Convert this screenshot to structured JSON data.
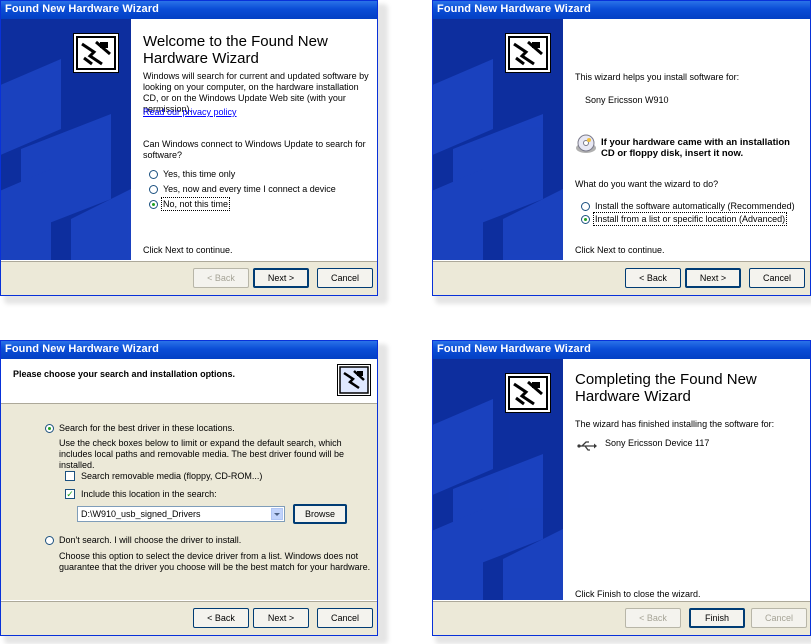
{
  "wizard_title": "Found New Hardware Wizard",
  "colors": {
    "titlebar": "#0a4dd6",
    "left_panel": "#0d2e9e",
    "dialog_bg": "#ece9d8",
    "link": "#0000ff"
  },
  "screen1": {
    "heading": "Welcome to the Found New Hardware Wizard",
    "intro": "Windows will search for current and updated software by looking on your computer, on the hardware installation CD, or on the Windows Update Web site (with your permission).",
    "privacy_link": "Read our privacy policy",
    "question": "Can Windows connect to Windows Update to search for software?",
    "options": [
      "Yes, this time only",
      "Yes, now and every time I connect a device",
      "No, not this time"
    ],
    "selected": 2,
    "footer": "Click Next to continue.",
    "buttons": {
      "back": "< Back",
      "next": "Next >",
      "cancel": "Cancel"
    }
  },
  "screen2": {
    "intro": "This wizard helps you install software for:",
    "device": "Sony Ericsson W910",
    "cd_notice": "If your hardware came with an installation CD or floppy disk, insert it now.",
    "question": "What do you want the wizard to do?",
    "options": [
      "Install the software automatically (Recommended)",
      "Install from a list or specific location (Advanced)"
    ],
    "selected": 1,
    "footer": "Click Next to continue.",
    "buttons": {
      "back": "< Back",
      "next": "Next >",
      "cancel": "Cancel"
    }
  },
  "screen3": {
    "header": "Please choose your search and installation options.",
    "option_search": "Search for the best driver in these locations.",
    "search_desc": "Use the check boxes below to limit or expand the default search, which includes local paths and removable media. The best driver found will be installed.",
    "chk_removable": "Search removable media (floppy, CD-ROM...)",
    "chk_include": "Include this location in the search:",
    "path_value": "D:\\W910_usb_signed_Drivers",
    "browse": "Browse",
    "option_manual": "Don't search. I will choose the driver to install.",
    "manual_desc": "Choose this option to select the device driver from a list. Windows does not guarantee that the driver you choose will be the best match for your hardware.",
    "buttons": {
      "back": "< Back",
      "next": "Next >",
      "cancel": "Cancel"
    }
  },
  "screen4": {
    "heading": "Completing the Found New Hardware Wizard",
    "intro": "The wizard has finished installing the software for:",
    "device": "Sony Ericsson Device 117",
    "footer": "Click Finish to close the wizard.",
    "buttons": {
      "back": "< Back",
      "finish": "Finish",
      "cancel": "Cancel"
    }
  }
}
